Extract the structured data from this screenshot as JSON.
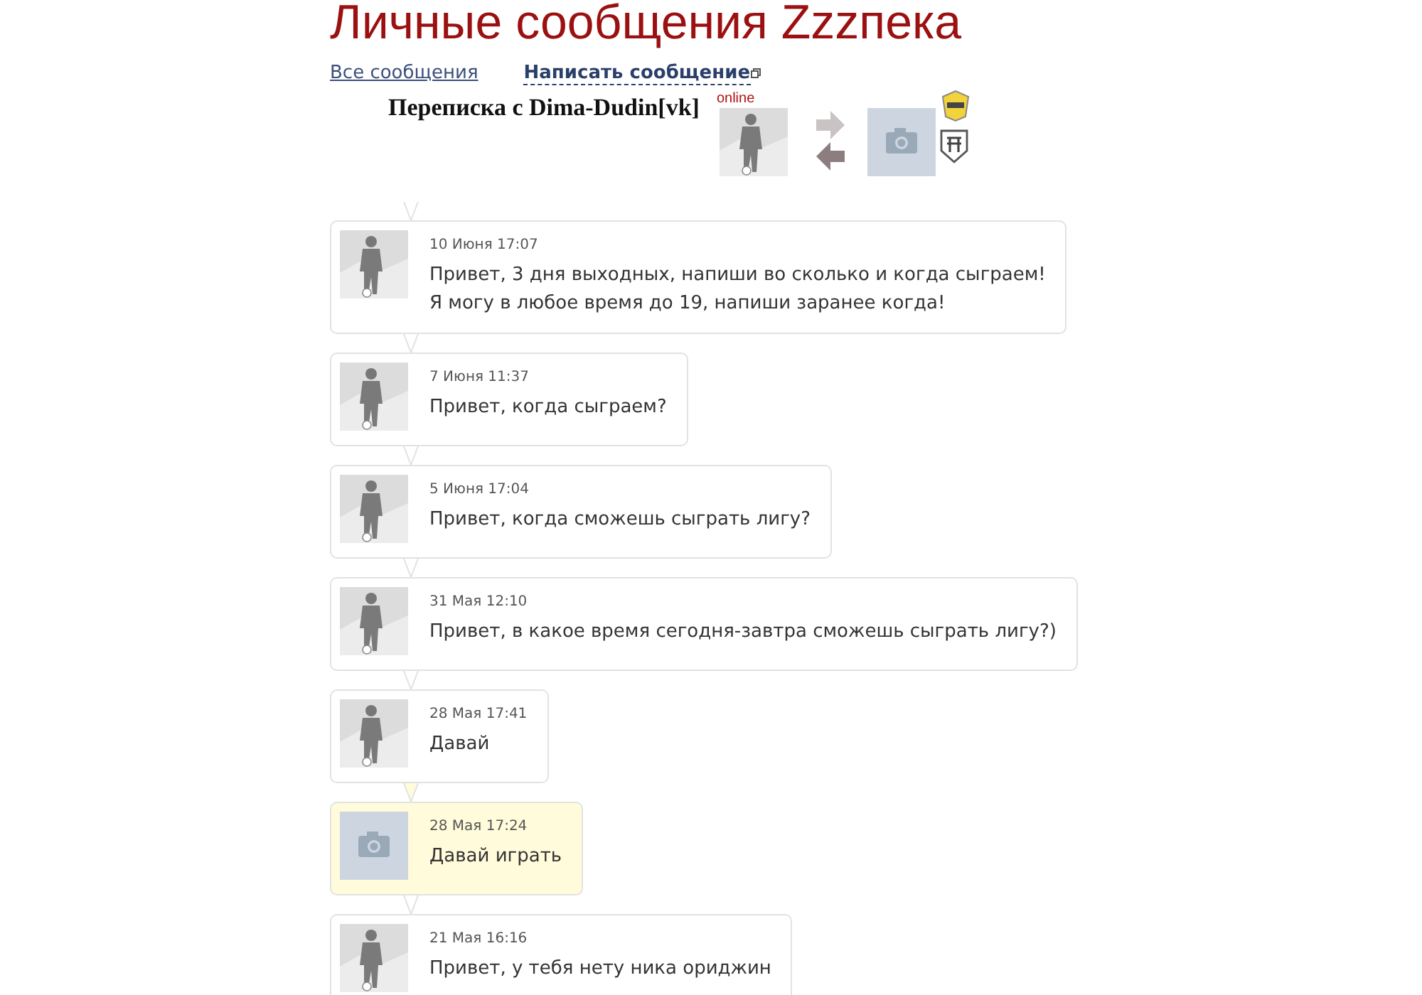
{
  "page_title": "Личные сообщения Zzzпека",
  "nav": [
    {
      "label": "Все сообщения",
      "selected": false
    },
    {
      "label": "Написать сообщение",
      "selected": true
    }
  ],
  "conversation": {
    "title": "Переписка с Dima-Dudin[vk]",
    "status": "online"
  },
  "messages": [
    {
      "kind": "incoming",
      "date": "10 Июня 17:07",
      "lines": [
        "Привет, 3 дня выходных, напиши во сколько и когда сыграем!",
        "Я могу в любое время до 19, напиши заранее когда!"
      ]
    },
    {
      "kind": "incoming",
      "date": "7 Июня 11:37",
      "lines": [
        "Привет, когда сыграем?"
      ]
    },
    {
      "kind": "incoming",
      "date": "5 Июня 17:04",
      "lines": [
        "Привет, когда сможешь сыграть лигу?"
      ]
    },
    {
      "kind": "incoming",
      "date": "31 Мая 12:10",
      "lines": [
        "Привет, в какое время сегодня-завтра сможешь сыграть лигу?)"
      ]
    },
    {
      "kind": "incoming",
      "date": "28 Мая 17:41",
      "lines": [
        "Давай"
      ]
    },
    {
      "kind": "outgoing",
      "date": "28 Мая 17:24",
      "lines": [
        "Давай играть"
      ]
    },
    {
      "kind": "incoming",
      "date": "21 Мая 16:16",
      "lines": [
        "Привет, у тебя нету ника ориджин"
      ]
    }
  ]
}
